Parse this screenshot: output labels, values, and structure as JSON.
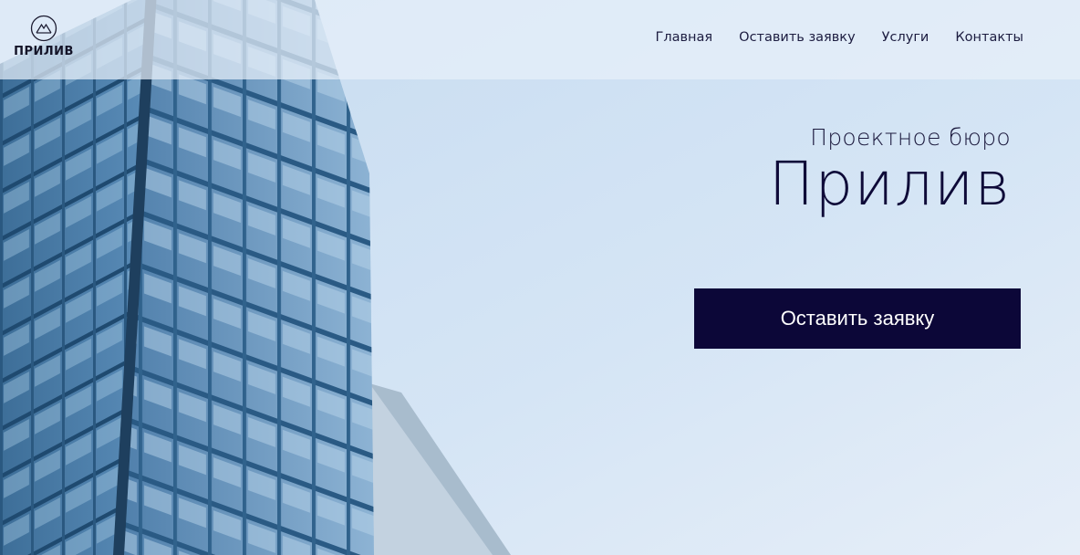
{
  "brand": {
    "logo_text": "ПРИЛИВ",
    "logo_icon": "mountain-circle-icon"
  },
  "nav": {
    "items": [
      {
        "label": "Главная"
      },
      {
        "label": "Оставить заявку"
      },
      {
        "label": "Услуги"
      },
      {
        "label": "Контакты"
      }
    ]
  },
  "hero": {
    "subtitle": "Проектное бюро",
    "title": "Прилив",
    "cta_label": "Оставить заявку"
  },
  "colors": {
    "primary_dark": "#0c0738",
    "header_bg": "#e8f0fa",
    "sky": "#d4e4f4"
  }
}
